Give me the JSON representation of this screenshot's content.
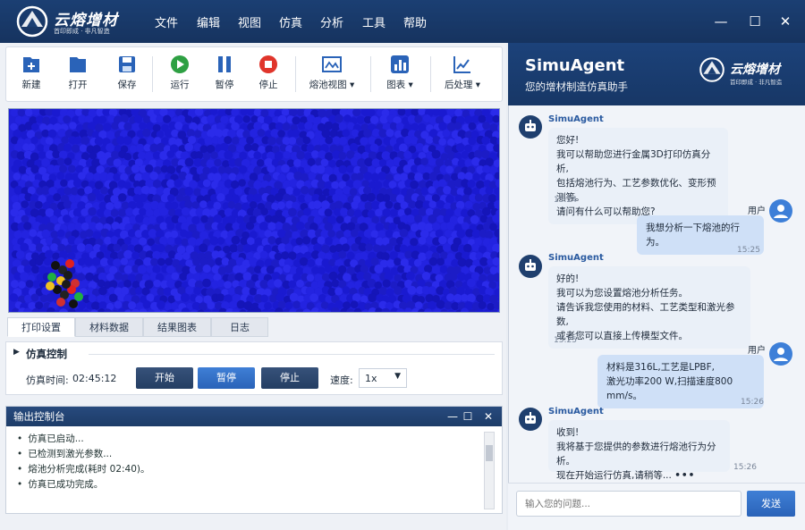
{
  "app": {
    "brand": "云熔增材",
    "slogan": "首印即成 · 非凡智造"
  },
  "menu": [
    "文件",
    "编辑",
    "视图",
    "仿真",
    "分析",
    "工具",
    "帮助"
  ],
  "toolbar": {
    "new": "新建",
    "open": "打开",
    "save": "保存",
    "run": "运行",
    "pause": "暂停",
    "stop": "停止",
    "pool_view": "熔池视图",
    "chart": "图表",
    "post": "后处理"
  },
  "tabs": [
    "打印设置",
    "材料数据",
    "结果图表",
    "日志"
  ],
  "sim": {
    "section_title": "仿真控制",
    "time_label": "仿真时间:",
    "time_value": "02:45:12",
    "start": "开始",
    "pause": "暂停",
    "stop": "停止",
    "speed_label": "速度:",
    "speed_value": "1x"
  },
  "console": {
    "title": "输出控制台",
    "lines": [
      "仿真已启动...",
      "已检测到激光参数...",
      "熔池分析完成(耗时 02:40)。",
      "仿真已成功完成。"
    ]
  },
  "agent": {
    "title": "SimuAgent",
    "subtitle": "您的增材制造仿真助手",
    "brand": "云熔增材",
    "slogan": "首印即成 · 非凡智造",
    "agent_name": "SimuAgent",
    "user_name": "用户",
    "messages": [
      {
        "from": "agent",
        "lines": [
          "您好!",
          "我可以帮助您进行金属3D打印仿真分析,",
          "包括熔池行为、工艺参数优化、变形预测等。",
          "请问有什么可以帮助您?"
        ],
        "time": "15:24"
      },
      {
        "from": "user",
        "lines": [
          "我想分析一下熔池的行为。"
        ],
        "time": "15:25"
      },
      {
        "from": "agent",
        "lines": [
          "好的!",
          "我可以为您设置熔池分析任务。",
          "请告诉我您使用的材料、工艺类型和激光参数,",
          "或者您可以直接上传模型文件。"
        ],
        "time": "15:25"
      },
      {
        "from": "user",
        "lines": [
          "材料是316L,工艺是LPBF,",
          "激光功率200 W,扫描速度800 mm/s。"
        ],
        "time": "15:26"
      },
      {
        "from": "agent",
        "lines": [
          "收到!",
          "我将基于您提供的参数进行熔池行为分析。",
          "现在开始运行仿真,请稍等..."
        ],
        "time": "15:26",
        "typing": "•••"
      }
    ],
    "input_placeholder": "输入您的问题...",
    "send": "发送"
  },
  "colors": {
    "accent": "#2a63b8",
    "header": "#1b3f73",
    "particle": "#2020d8"
  }
}
